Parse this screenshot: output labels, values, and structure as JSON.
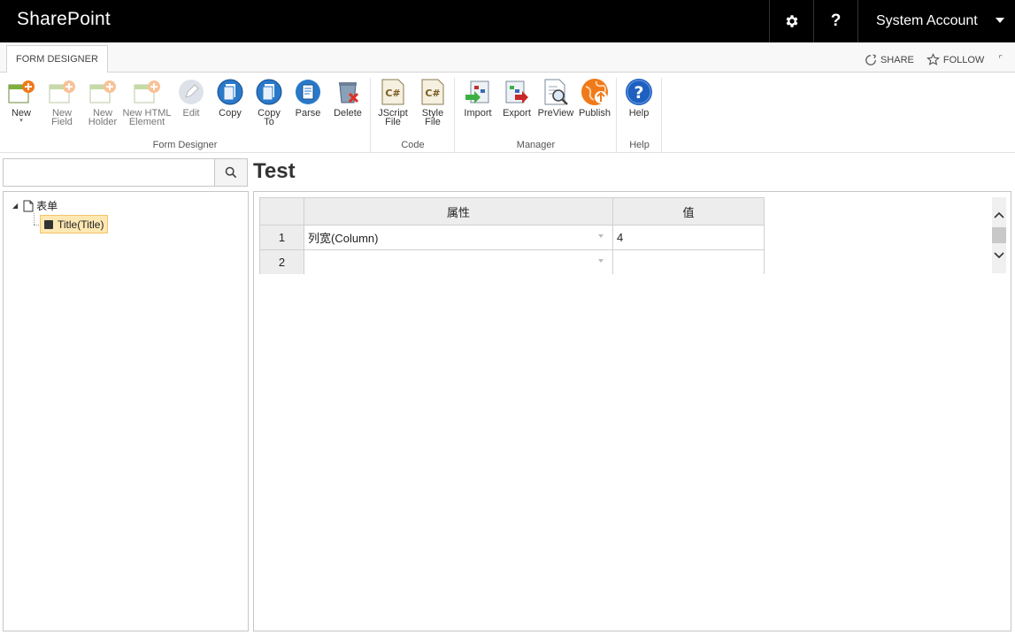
{
  "suitebar": {
    "brand": "SharePoint",
    "help_label": "?",
    "account": "System Account"
  },
  "tabs": {
    "active": "FORM DESIGNER"
  },
  "page_actions": {
    "share": "SHARE",
    "follow": "FOLLOW"
  },
  "ribbon": {
    "groups": [
      {
        "label": "Form Designer",
        "buttons": [
          {
            "line1": "New",
            "line2": ""
          },
          {
            "line1": "New",
            "line2": "Field"
          },
          {
            "line1": "New",
            "line2": "Holder"
          },
          {
            "line1": "New HTML",
            "line2": "Element"
          },
          {
            "line1": "Edit",
            "line2": ""
          },
          {
            "line1": "Copy",
            "line2": ""
          },
          {
            "line1": "Copy",
            "line2": "To"
          },
          {
            "line1": "Parse",
            "line2": ""
          },
          {
            "line1": "Delete",
            "line2": ""
          }
        ]
      },
      {
        "label": "Code",
        "buttons": [
          {
            "line1": "JScript",
            "line2": "File",
            "glyph": "C#"
          },
          {
            "line1": "Style",
            "line2": "File",
            "glyph": "C#"
          }
        ]
      },
      {
        "label": "Manager",
        "buttons": [
          {
            "line1": "Import",
            "line2": ""
          },
          {
            "line1": "Export",
            "line2": ""
          },
          {
            "line1": "PreView",
            "line2": ""
          },
          {
            "line1": "Publish",
            "line2": ""
          }
        ]
      },
      {
        "label": "Help",
        "buttons": [
          {
            "line1": "Help",
            "line2": ""
          }
        ]
      }
    ]
  },
  "search": {
    "value": "",
    "placeholder": ""
  },
  "tree": {
    "root": "表单",
    "child": "Title(Title)"
  },
  "main": {
    "title": "Test",
    "grid": {
      "headers": [
        "属性",
        "值"
      ],
      "rows": [
        {
          "num": "1",
          "prop": "列宽(Column)",
          "value": "4"
        },
        {
          "num": "2",
          "prop": "",
          "value": ""
        }
      ]
    }
  },
  "colors": {
    "suitebar_bg": "#000000",
    "selected_node_bg": "#fde8b3",
    "publish_orange": "#f07a1a",
    "help_blue": "#1e5fbf"
  }
}
